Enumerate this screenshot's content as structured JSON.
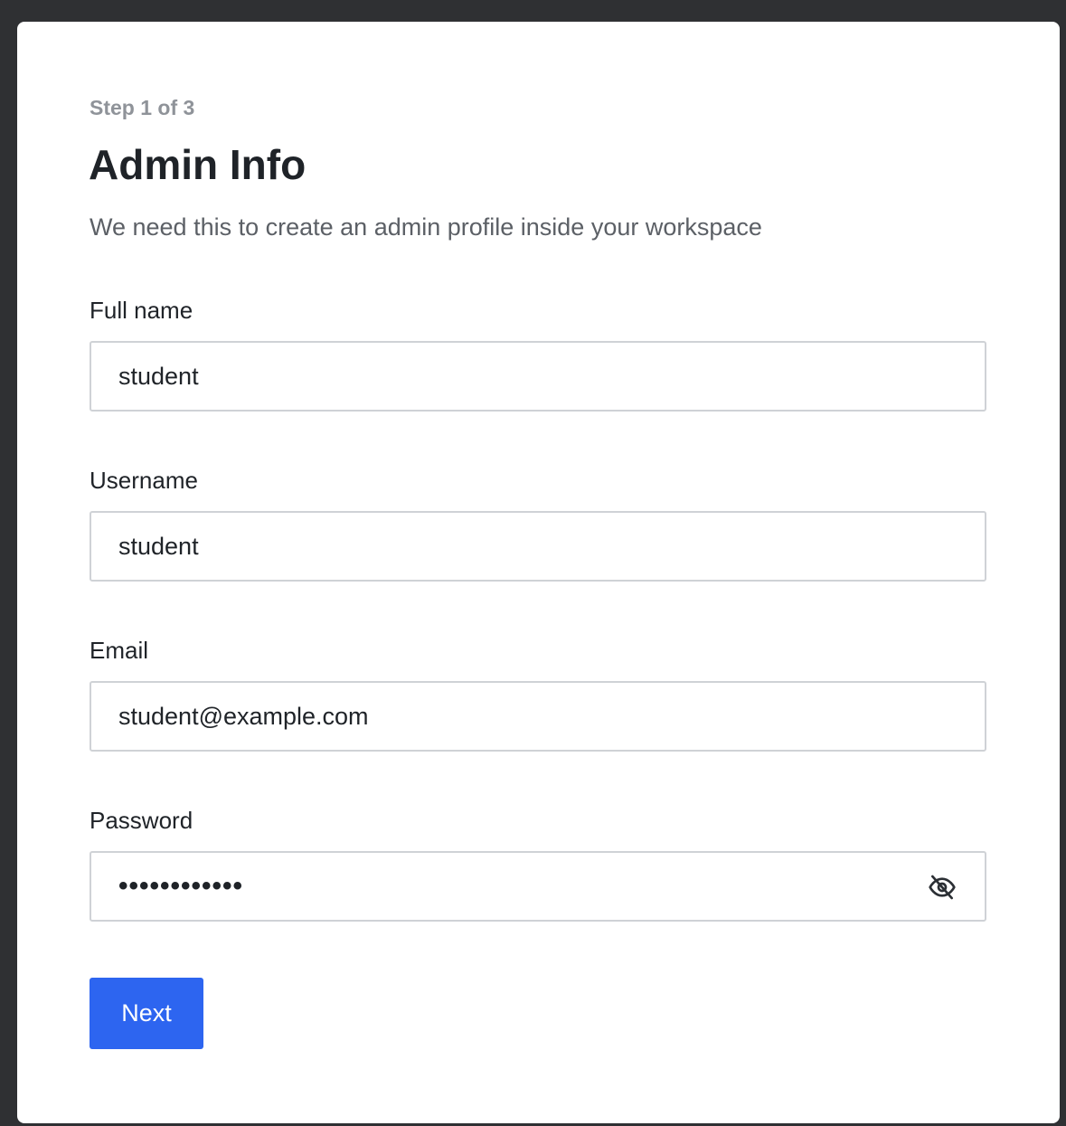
{
  "form": {
    "step_text": "Step 1 of 3",
    "title": "Admin Info",
    "subtitle": "We need this to create an admin profile inside your workspace",
    "full_name": {
      "label": "Full name",
      "value": "student"
    },
    "username": {
      "label": "Username",
      "value": "student"
    },
    "email": {
      "label": "Email",
      "value": "student@example.com"
    },
    "password": {
      "label": "Password",
      "masked_value": "••••••••••••",
      "toggle_icon": "eye-off-icon"
    },
    "next_label": "Next"
  },
  "colors": {
    "primary": "#2d65f0",
    "backdrop": "#2f3033",
    "input_border": "#cfd2d6",
    "muted_text": "#8f9399"
  }
}
